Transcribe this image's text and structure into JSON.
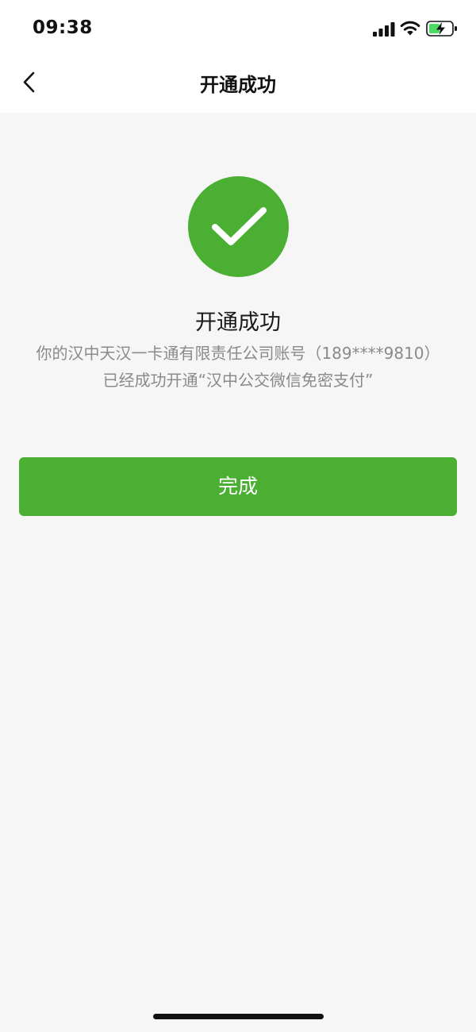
{
  "status_bar": {
    "time": "09:38",
    "signal_icon": "signal-bars-icon",
    "wifi_icon": "wifi-icon",
    "battery_icon": "battery-charging-icon"
  },
  "nav": {
    "back_icon": "chevron-left-icon",
    "title": "开通成功"
  },
  "result": {
    "icon": "checkmark-circle-icon",
    "title": "开通成功",
    "description": "你的汉中天汉一卡通有限责任公司账号（189****9810）已经成功开通“汉中公交微信免密支付”"
  },
  "actions": {
    "done_label": "完成"
  },
  "colors": {
    "accent": "#4aaf32",
    "background": "#f6f6f6",
    "header_background": "#ffffff",
    "description_text": "#8a8a8a"
  }
}
